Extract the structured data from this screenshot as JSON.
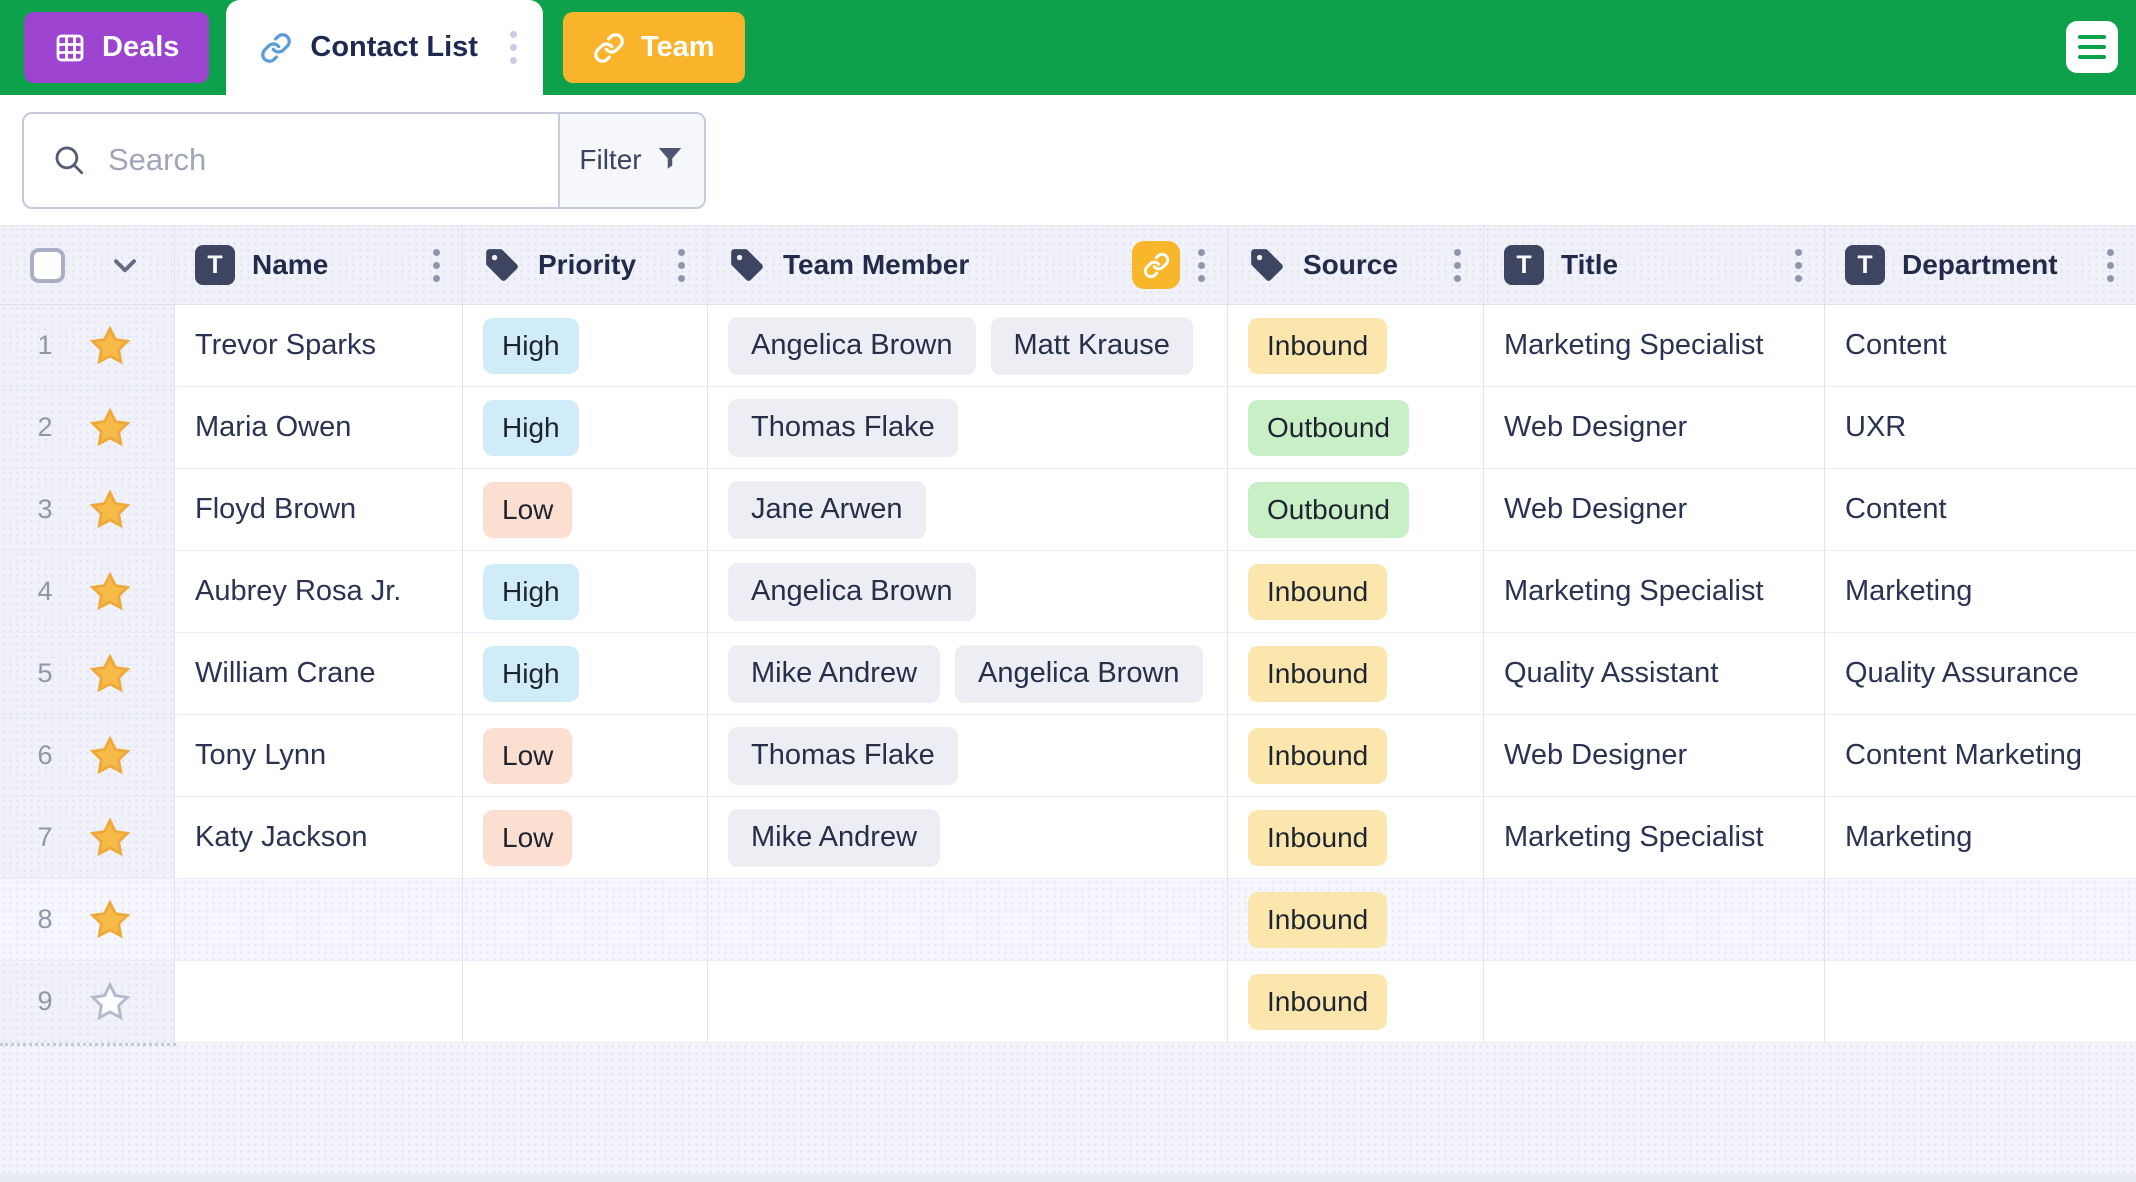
{
  "topbar": {
    "tabs": [
      {
        "label": "Deals",
        "icon": "grid-icon",
        "active": false
      },
      {
        "label": "Contact List",
        "icon": "link-icon",
        "active": true
      },
      {
        "label": "Team",
        "icon": "link-icon",
        "active": false
      }
    ],
    "menu_icon": "hamburger-icon"
  },
  "toolbar": {
    "search_placeholder": "Search",
    "search_value": "",
    "filter_label": "Filter"
  },
  "table": {
    "icons": {
      "text_badge": "T"
    },
    "columns": [
      {
        "label": "Name",
        "icon": "text-field-icon"
      },
      {
        "label": "Priority",
        "icon": "tag-icon"
      },
      {
        "label": "Team Member",
        "icon": "tag-icon",
        "linked": true
      },
      {
        "label": "Source",
        "icon": "tag-icon"
      },
      {
        "label": "Title",
        "icon": "text-field-icon"
      },
      {
        "label": "Department",
        "icon": "text-field-icon"
      }
    ],
    "rows": [
      {
        "num": 1,
        "starred": true,
        "tinted": false,
        "name": "Trevor Sparks",
        "priority": "High",
        "team": [
          "Angelica Brown",
          "Matt Krause"
        ],
        "source": "Inbound",
        "title": "Marketing Specialist",
        "department": "Content"
      },
      {
        "num": 2,
        "starred": true,
        "tinted": false,
        "name": "Maria Owen",
        "priority": "High",
        "team": [
          "Thomas Flake"
        ],
        "source": "Outbound",
        "title": "Web Designer",
        "department": "UXR"
      },
      {
        "num": 3,
        "starred": true,
        "tinted": false,
        "name": "Floyd Brown",
        "priority": "Low",
        "team": [
          "Jane Arwen"
        ],
        "source": "Outbound",
        "title": "Web Designer",
        "department": "Content"
      },
      {
        "num": 4,
        "starred": true,
        "tinted": false,
        "name": "Aubrey Rosa Jr.",
        "priority": "High",
        "team": [
          "Angelica Brown"
        ],
        "source": "Inbound",
        "title": "Marketing Specialist",
        "department": "Marketing"
      },
      {
        "num": 5,
        "starred": true,
        "tinted": false,
        "name": "William Crane",
        "priority": "High",
        "team": [
          "Mike Andrew",
          "Angelica Brown"
        ],
        "source": "Inbound",
        "title": "Quality Assistant",
        "department": "Quality Assurance"
      },
      {
        "num": 6,
        "starred": true,
        "tinted": false,
        "name": "Tony Lynn",
        "priority": "Low",
        "team": [
          "Thomas Flake"
        ],
        "source": "Inbound",
        "title": "Web Designer",
        "department": "Content Marketing"
      },
      {
        "num": 7,
        "starred": true,
        "tinted": false,
        "name": "Katy Jackson",
        "priority": "Low",
        "team": [
          "Mike Andrew"
        ],
        "source": "Inbound",
        "title": "Marketing Specialist",
        "department": "Marketing"
      },
      {
        "num": 8,
        "starred": true,
        "tinted": true,
        "name": "",
        "priority": "",
        "team": [],
        "source": "Inbound",
        "title": "",
        "department": ""
      },
      {
        "num": 9,
        "starred": false,
        "tinted": false,
        "name": "",
        "priority": "",
        "team": [],
        "source": "Inbound",
        "title": "",
        "department": ""
      }
    ],
    "badge_colors": {
      "High": "#D0ECF9",
      "Low": "#FBDFD0",
      "Inbound": "#FBE7AE",
      "Outbound": "#C9EFC6"
    }
  },
  "colors": {
    "topbar_green": "#0DA14C",
    "deals_purple": "#9C43D0",
    "team_orange": "#F9B42C",
    "linked_field_amber": "#F8B62B",
    "star_gold": "#F6BA49",
    "header_navy": "#222B4A"
  }
}
